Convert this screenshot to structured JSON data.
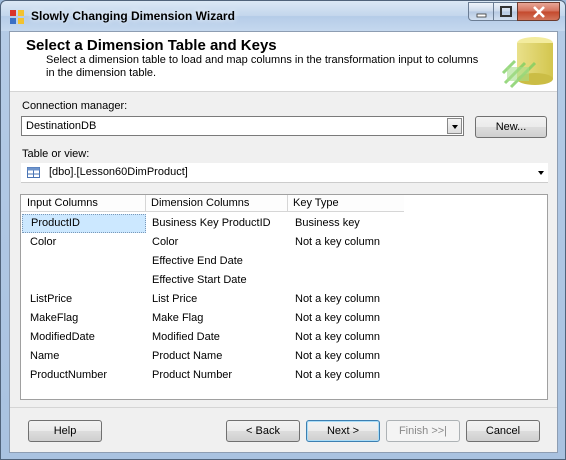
{
  "window": {
    "title": "Slowly Changing Dimension Wizard"
  },
  "header": {
    "title": "Select a Dimension Table and Keys",
    "description": "Select a dimension table to load and map columns in the transformation input to columns in the dimension table."
  },
  "connection": {
    "label": "Connection manager:",
    "value": "DestinationDB",
    "new_button": "New..."
  },
  "table": {
    "label": "Table or view:",
    "value": "[dbo].[Lesson60DimProduct]"
  },
  "grid": {
    "headers": [
      "Input Columns",
      "Dimension Columns",
      "Key Type"
    ],
    "rows": [
      {
        "input": "ProductID",
        "dimension": "Business Key ProductID",
        "key": "Business key"
      },
      {
        "input": "Color",
        "dimension": "Color",
        "key": "Not a key column"
      },
      {
        "input": "",
        "dimension": "Effective End Date",
        "key": ""
      },
      {
        "input": "",
        "dimension": "Effective Start Date",
        "key": ""
      },
      {
        "input": "ListPrice",
        "dimension": "List Price",
        "key": "Not a key column"
      },
      {
        "input": "MakeFlag",
        "dimension": "Make Flag",
        "key": "Not a key column"
      },
      {
        "input": "ModifiedDate",
        "dimension": "Modified Date",
        "key": "Not a key column"
      },
      {
        "input": "Name",
        "dimension": "Product Name",
        "key": "Not a key column"
      },
      {
        "input": "ProductNumber",
        "dimension": "Product Number",
        "key": "Not a key column"
      }
    ]
  },
  "buttons": {
    "help": "Help",
    "back": "< Back",
    "next": "Next >",
    "finish": "Finish >>|",
    "cancel": "Cancel"
  }
}
